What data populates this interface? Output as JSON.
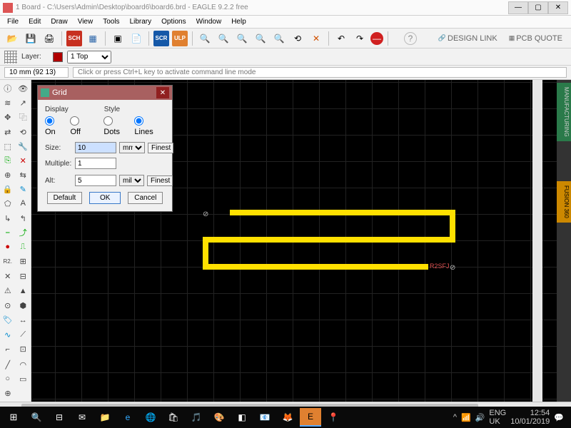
{
  "title": "1 Board - C:\\Users\\Admin\\Desktop\\board6\\board6.brd - EAGLE 9.2.2 free",
  "menu": {
    "file": "File",
    "edit": "Edit",
    "draw": "Draw",
    "view": "View",
    "tools": "Tools",
    "library": "Library",
    "options": "Options",
    "window": "Window",
    "help": "Help"
  },
  "toolbar": {
    "design_link": "DESIGN LINK",
    "pcb_quote": "PCB QUOTE"
  },
  "layer": {
    "label": "Layer:",
    "value": "1 Top"
  },
  "coord": "10 mm (92 13)",
  "cmdline_placeholder": "Click or press Ctrl+L key to activate command line mode",
  "right": {
    "tab1": "MANUFACTURING",
    "tab2": "FUSION 360"
  },
  "pcb_part_name": "R2SFJ",
  "dialog": {
    "title": "Grid",
    "display_label": "Display",
    "style_label": "Style",
    "on": "On",
    "off": "Off",
    "dots": "Dots",
    "lines": "Lines",
    "size_label": "Size:",
    "size_value": "10",
    "size_unit": "mm",
    "finest": "Finest",
    "multiple_label": "Multiple:",
    "multiple_value": "1",
    "alt_label": "Alt:",
    "alt_value": "5",
    "alt_unit": "mil",
    "default": "Default",
    "ok": "OK",
    "cancel": "Cancel"
  },
  "tray": {
    "lang": "ENG",
    "kb": "UK",
    "time": "12:54",
    "date": "10/01/2019"
  }
}
